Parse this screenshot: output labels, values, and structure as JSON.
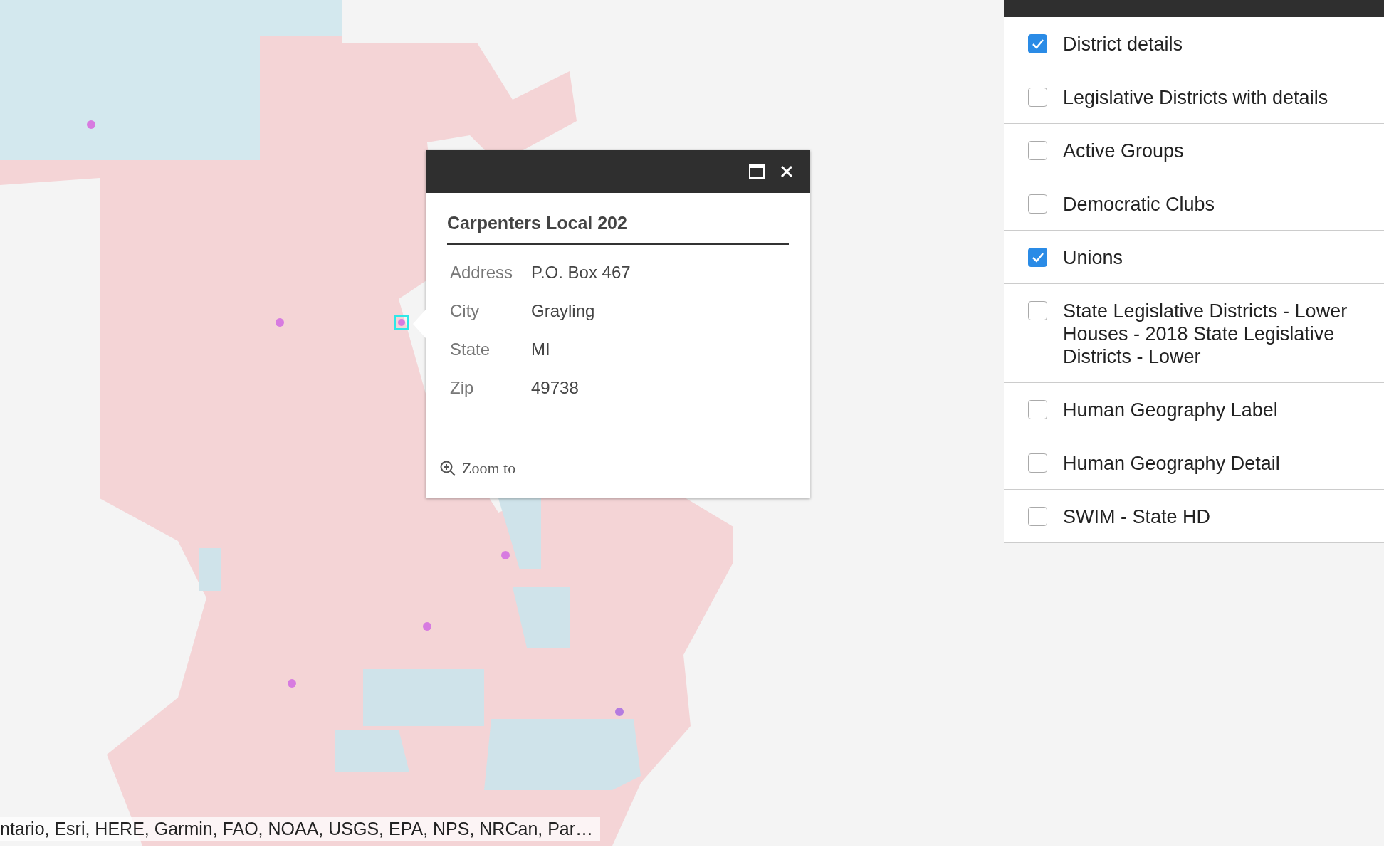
{
  "popup": {
    "title": "Carpenters Local 202",
    "fields": [
      {
        "label": "Address",
        "value": "P.O. Box 467"
      },
      {
        "label": "City",
        "value": "Grayling"
      },
      {
        "label": "State",
        "value": "MI"
      },
      {
        "label": "Zip",
        "value": "49738"
      }
    ],
    "zoom_link": "Zoom to"
  },
  "layer_list": {
    "items": [
      {
        "label": "District details",
        "checked": true
      },
      {
        "label": "Legislative Districts with details",
        "checked": false
      },
      {
        "label": "Active Groups",
        "checked": false
      },
      {
        "label": "Democratic Clubs",
        "checked": false
      },
      {
        "label": "Unions",
        "checked": true
      },
      {
        "label": "State Legislative Districts - Lower Houses - 2018 State Legislative Districts - Lower",
        "checked": false
      },
      {
        "label": "Human Geography Label",
        "checked": false
      },
      {
        "label": "Human Geography Detail",
        "checked": false
      },
      {
        "label": "SWIM - State HD",
        "checked": false
      }
    ]
  },
  "attribution": "ntario, Esri, HERE, Garmin, FAO, NOAA, USGS, EPA, NPS, NRCan, Par…"
}
